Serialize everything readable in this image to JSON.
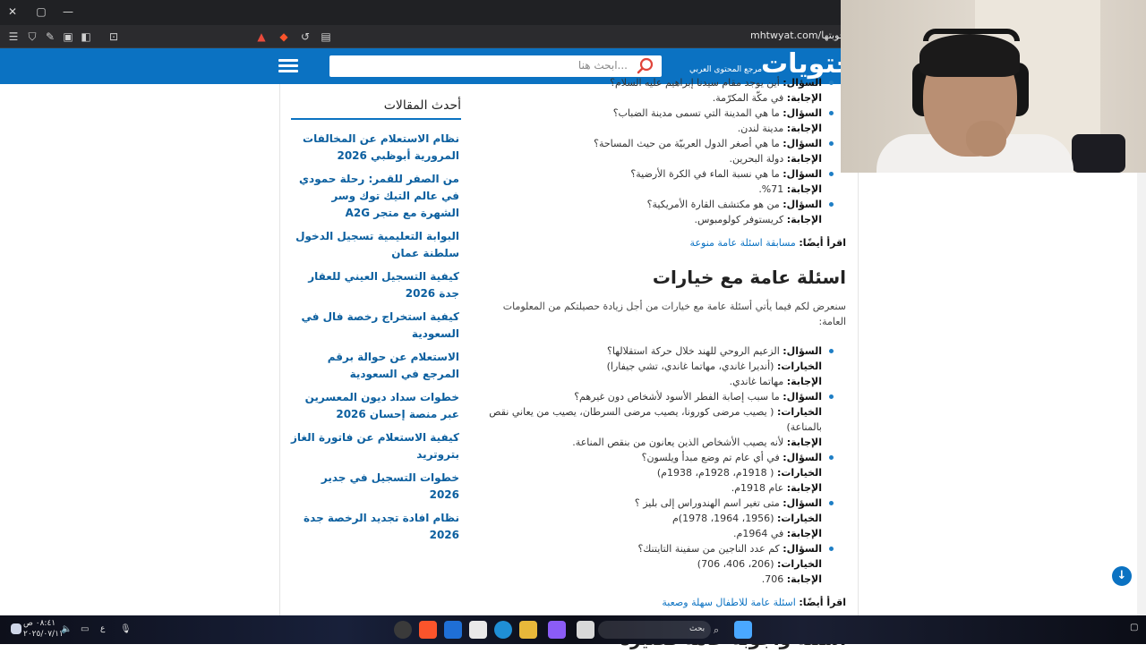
{
  "browser": {
    "url": "mhtwyat.com/عامة-واجوبتها/",
    "window_controls": [
      "✕",
      "▢",
      "—"
    ]
  },
  "header": {
    "logo": "محتويات",
    "tagline": "مرجع المحتوى العربي",
    "search_placeholder": "ابحث هنا..."
  },
  "sidebar": {
    "title": "أحدث المقالات",
    "links": [
      "نظام الاستعلام عن المخالفات المرورية أبوظبي 2026",
      "من الصفر للقمر: رحلة حمودي في عالم التيك توك وسر الشهرة مع متجر A2G",
      "البوابة التعليمية تسجيل الدخول سلطنة عمان",
      "كيفية التسجيل العيني للعقار جدة 2026",
      "كيفية استخراج رخصة فال في السعودية",
      "الاستعلام عن حوالة برقم المرجع في السعودية",
      "خطوات سداد ديون المعسرين عبر منصة إحسان 2026",
      "كيفية الاستعلام عن فاتورة الغاز بتروتريد",
      "خطوات التسجيل في جدير 2026",
      "نظام افادة تجديد الرخصة جدة 2026"
    ]
  },
  "labels": {
    "question": "السؤال:",
    "answer": "الإجابة:",
    "choices": "الخيارات:",
    "read_also": "اقرأ أيضًا:"
  },
  "section1": {
    "items": [
      {
        "q": "أين يوجد مقام سيدنا إبراهيم عليه السلام؟",
        "a": "في مكّة المكرّمة."
      },
      {
        "q": "ما هي المدينة التي تسمى مدينة الضباب؟",
        "a": "مدينة لندن."
      },
      {
        "q": "ما هي أصغر الدول العربيّة من حيث المساحة؟",
        "a": "دولة البحرين."
      },
      {
        "q": "ما هي نسبة الماء في الكرة الأرضية؟",
        "a": "71%."
      },
      {
        "q": "من هو مكتشف القارة الأمريكية؟",
        "a": "كريستوفر كولومبوس."
      }
    ],
    "read_also_link": "مسابقة اسئلة عامة منوعة"
  },
  "section2": {
    "heading": "اسئلة عامة مع خيارات",
    "intro": "سنعرض لكم فيما يأتي أسئلة عامة مع خيارات من أجل زيادة حصيلتكم من المعلومات العامة:",
    "items": [
      {
        "q": "الزعيم الروحي للهند خلال حركة استقلالها؟",
        "c": "(أنديرا غاندي، مهاتما غاندي، تشي جيفارا)",
        "a": "مهاتما غاندي."
      },
      {
        "q": "ما سبب إصابة الفطر الأسود لأشخاص دون غيرهم؟",
        "c": "( يصيب مرضى كورونا، يصيب مرضى السرطان، يصيب من يعاني نقص بالمناعة)",
        "a": "لأنه يصيب الأشخاص الذين يعانون من بنقص المناعة."
      },
      {
        "q": "في أي عام تم وضع مبدأ ويلسون؟",
        "c": "( 1918م، 1928م، 1938م)",
        "a": "عام 1918م."
      },
      {
        "q": "متى تغير اسم الهندوراس إلى بليز ؟",
        "c": "(1956، 1964، 1978)م",
        "a": "في 1964م."
      },
      {
        "q": "كم عدد الناجين من سفينة التايتنك؟",
        "c": "(206، 406، 706)",
        "a": "706."
      }
    ],
    "read_also_link": "اسئلة عامة للاطفال سهلة وصعبة"
  },
  "section3": {
    "heading": "اسئلة واجوبة عامة قصيرة"
  },
  "taskbar": {
    "search_label": "بحث",
    "time": "٠٨:٤١ ص",
    "date": "٢٠٢٥/٠٧/١١",
    "lang": "ع"
  }
}
